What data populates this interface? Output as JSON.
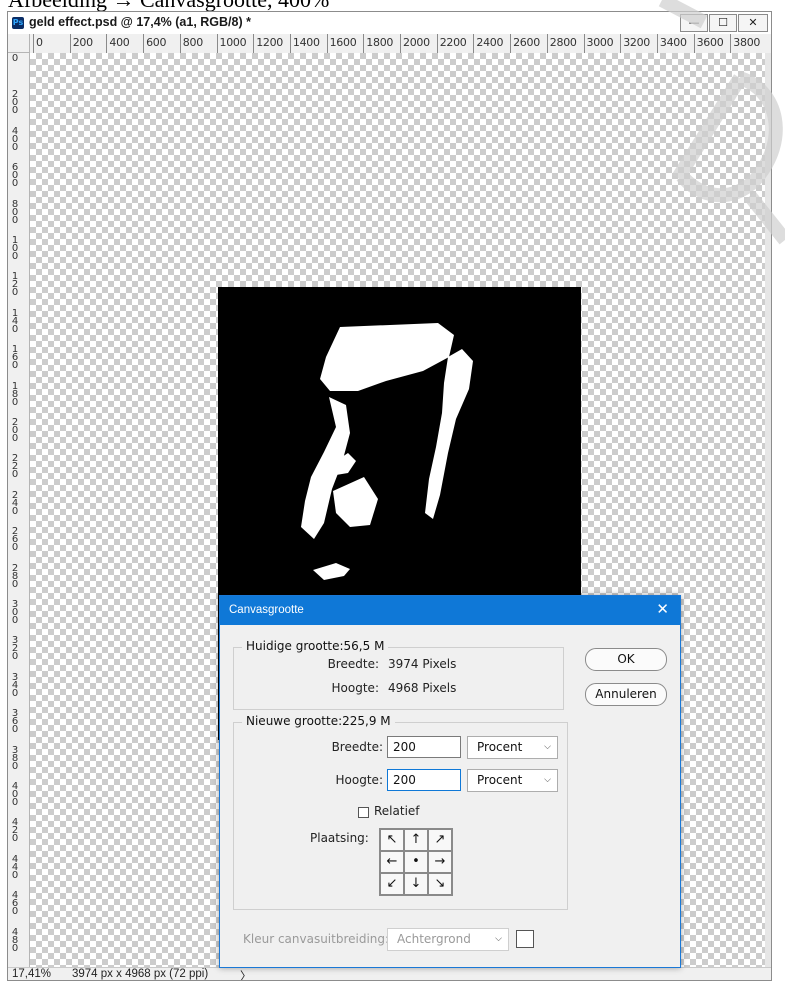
{
  "caption": "Afbeelding → Canvasgrootte, 400%",
  "window": {
    "title": "geld effect.psd @ 17,4% (a1, RGB/8) *",
    "app_icon": "Ps",
    "min_label": "—",
    "max_label": "☐",
    "close_label": "✕"
  },
  "ruler": {
    "top_labels": [
      "0",
      "200",
      "400",
      "600",
      "800",
      "1000",
      "1200",
      "1400",
      "1600",
      "1800",
      "2000",
      "2200",
      "2400",
      "2600",
      "2800",
      "3000",
      "3200",
      "3400",
      "3600",
      "3800"
    ],
    "left_labels": [
      "0",
      "2\n0\n0",
      "4\n0\n0",
      "6\n0\n0",
      "8\n0\n0",
      "1\n0\n0",
      "1\n2\n0",
      "1\n4\n0",
      "1\n6\n0",
      "1\n8\n0",
      "2\n0\n0",
      "2\n2\n0",
      "2\n4\n0",
      "2\n6\n0",
      "2\n8\n0",
      "3\n0\n0",
      "3\n2\n0",
      "3\n4\n0",
      "3\n6\n0",
      "3\n8\n0",
      "4\n0\n0",
      "4\n2\n0",
      "4\n4\n0",
      "4\n6\n0",
      "4\n8\n0"
    ]
  },
  "status": {
    "zoom": "17,41%",
    "doc_size": "3974 px x 4968 px (72 ppi)",
    "arrow": "〉"
  },
  "dialog": {
    "title": "Canvasgrootte",
    "close": "✕",
    "current": {
      "legend": "Huidige grootte:56,5 M",
      "width_label": "Breedte:",
      "width_value": "3974 Pixels",
      "height_label": "Hoogte:",
      "height_value": "4968 Pixels"
    },
    "new": {
      "legend": "Nieuwe grootte:225,9 M",
      "width_label": "Breedte:",
      "width_value": "200",
      "width_unit": "Procent",
      "height_label": "Hoogte:",
      "height_value": "200",
      "height_unit": "Procent",
      "relative_label": "Relatief",
      "relative_checked": false,
      "anchor_label": "Plaatsing:",
      "anchor_cells": [
        "↖",
        "↑",
        "↗",
        "←",
        "•",
        "→",
        "↙",
        "↓",
        "↘"
      ]
    },
    "extension_label": "Kleur canvasuitbreiding:",
    "extension_value": "Achtergrond",
    "ok_label": "OK",
    "cancel_label": "Annuleren"
  },
  "colors": {
    "accent": "#0f78d7",
    "image_bg": "#000000",
    "face": "#ffffff"
  }
}
